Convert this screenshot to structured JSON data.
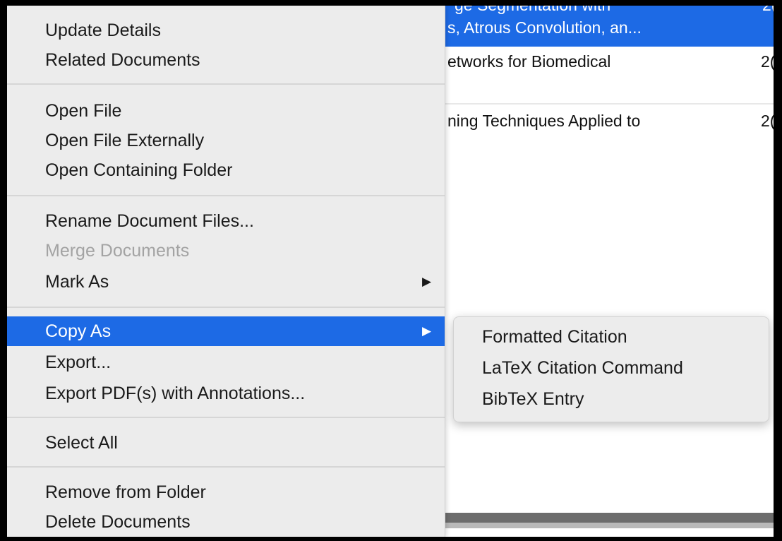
{
  "document_list": {
    "selected_row": {
      "title_cut": "ge Segmentation with",
      "title": "s, Atrous Convolution, an...",
      "year": "2("
    },
    "rows": [
      {
        "title": "etworks for Biomedical",
        "year": "2("
      },
      {
        "title": "ning Techniques Applied to",
        "year": "2("
      }
    ]
  },
  "context_menu": {
    "items": {
      "update_details": "Update Details",
      "related_documents": "Related Documents",
      "open_file": "Open File",
      "open_file_externally": "Open File Externally",
      "open_containing_folder": "Open Containing Folder",
      "rename_document_files": "Rename Document Files...",
      "merge_documents": "Merge Documents",
      "mark_as": "Mark As",
      "copy_as": "Copy As",
      "export": "Export...",
      "export_pdfs": "Export PDF(s) with Annotations...",
      "select_all": "Select All",
      "remove_from_folder": "Remove from Folder",
      "delete_documents": "Delete Documents"
    },
    "submenu_arrow": "▶"
  },
  "copy_as_submenu": {
    "items": [
      "Formatted Citation",
      "LaTeX Citation Command",
      "BibTeX Entry"
    ]
  },
  "colors": {
    "highlight": "#1d6ae5",
    "menu_bg": "#ececec",
    "disabled_text": "#a3a3a3"
  }
}
